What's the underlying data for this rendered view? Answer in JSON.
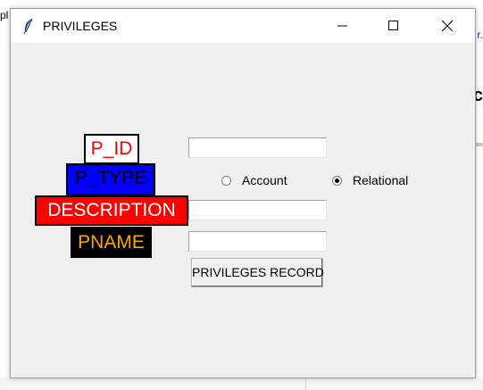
{
  "window": {
    "title": "PRIVILEGES",
    "icon": "feather-icon"
  },
  "background": {
    "left_text": "pl",
    "right_text": "r.",
    "right_heading": "c"
  },
  "labels": {
    "p_id": "P_ID",
    "p_type": "P_TYPE",
    "description": "DESCRIPTION",
    "pname": "PNAME"
  },
  "inputs": {
    "p_id": "",
    "description": "",
    "pname": ""
  },
  "radios": {
    "account": {
      "label": "Account",
      "checked": false
    },
    "relational": {
      "label": "Relational",
      "checked": true
    }
  },
  "button": {
    "label": "PRIVILEGES RECORD"
  },
  "colors": {
    "p_id_bg": "#ffffff",
    "p_id_fg": "#ff0000",
    "p_type_bg": "#0000ff",
    "p_type_fg": "#000000",
    "description_bg": "#ff0000",
    "description_fg": "#ffffff",
    "pname_bg": "#000000",
    "pname_fg": "#ffa500"
  }
}
